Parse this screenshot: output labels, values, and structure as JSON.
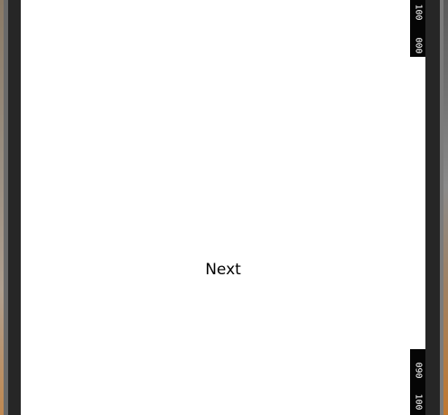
{
  "content": {
    "next_label": "Next"
  },
  "ruler": {
    "top_labels": [
      "100",
      "000"
    ],
    "bottom_labels": [
      "090",
      "100"
    ]
  },
  "colors": {
    "panel_background": "#ffffff",
    "bezel": "#262626",
    "ruler_block": "#050505",
    "text": "#000000"
  }
}
